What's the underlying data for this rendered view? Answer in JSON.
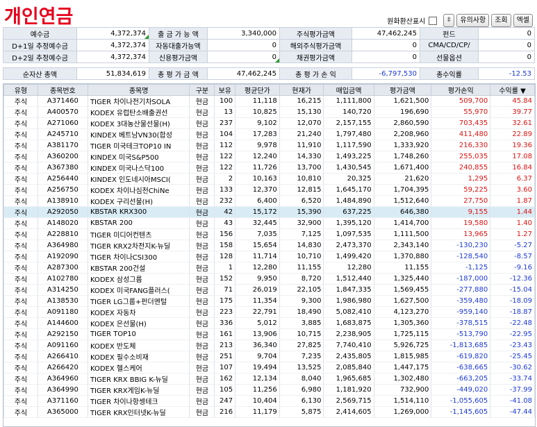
{
  "title": "개인연금",
  "controls": {
    "fx_label": "원화환산표시",
    "notes_label": "유의사항",
    "query_label": "조회",
    "excel_label": "엑셀"
  },
  "summary": {
    "r1": [
      "예수금",
      "4,372,374",
      "출 금 가 능 액",
      "3,340,000",
      "주식평가금액",
      "47,462,245",
      "펀드",
      "0"
    ],
    "r2": [
      "D+1일 추정예수금",
      "4,372,374",
      "자동대출가능액",
      "0",
      "해외주식평가금액",
      "0",
      "CMA/CD/CP/",
      "0"
    ],
    "r3": [
      "D+2일 추정예수금",
      "4,372,374",
      "신용평가금액",
      "0",
      "채권평가금액",
      "0",
      "선물옵션",
      "0"
    ],
    "r4": [
      "순자산 총액",
      "51,834,619",
      "총 평 가 금 액",
      "47,462,245",
      "총 평 가 손 익",
      "-6,797,530",
      "총수익률",
      "-12.53"
    ]
  },
  "columns": [
    "유형",
    "종목번호",
    "종목명",
    "구분",
    "보유",
    "평균단가",
    "현재가",
    "매입금액",
    "평가금액",
    "평가손익",
    "수익률 ▼"
  ],
  "rows": [
    [
      "주식",
      "A371460",
      "TIGER 차이나전기차SOLA",
      "현금",
      "100",
      "11,118",
      "16,215",
      "1,111,800",
      "1,621,500",
      "509,700",
      "45.84"
    ],
    [
      "주식",
      "A400570",
      "KODEX 유럽탄소배출권선",
      "현금",
      "13",
      "10,825",
      "15,130",
      "140,720",
      "196,690",
      "55,970",
      "39.77"
    ],
    [
      "주식",
      "A271060",
      "KODEX 3대농산물선물(H)",
      "현금",
      "237",
      "9,102",
      "12,070",
      "2,157,155",
      "2,860,590",
      "703,435",
      "32.61"
    ],
    [
      "주식",
      "A245710",
      "KINDEX 베트남VN30(합성",
      "현금",
      "104",
      "17,283",
      "21,240",
      "1,797,480",
      "2,208,960",
      "411,480",
      "22.89"
    ],
    [
      "주식",
      "A381170",
      "TIGER 미국테크TOP10 IN",
      "현금",
      "112",
      "9,978",
      "11,910",
      "1,117,590",
      "1,333,920",
      "216,330",
      "19.36"
    ],
    [
      "주식",
      "A360200",
      "KINDEX 미국S&P500",
      "현금",
      "122",
      "12,240",
      "14,330",
      "1,493,225",
      "1,748,260",
      "255,035",
      "17.08"
    ],
    [
      "주식",
      "A367380",
      "KINDEX 미국나스닥100",
      "현금",
      "122",
      "11,726",
      "13,700",
      "1,430,545",
      "1,671,400",
      "240,855",
      "16.84"
    ],
    [
      "주식",
      "A256440",
      "KINDEX 인도네시아MSCI(",
      "현금",
      "2",
      "10,163",
      "10,810",
      "20,325",
      "21,620",
      "1,295",
      "6.37"
    ],
    [
      "주식",
      "A256750",
      "KODEX 차이나심천ChiNe",
      "현금",
      "133",
      "12,370",
      "12,815",
      "1,645,170",
      "1,704,395",
      "59,225",
      "3.60"
    ],
    [
      "주식",
      "A138910",
      "KODEX 구리선물(H)",
      "현금",
      "232",
      "6,400",
      "6,520",
      "1,484,890",
      "1,512,640",
      "27,750",
      "1.87"
    ],
    [
      "주식",
      "A292050",
      "KBSTAR KRX300",
      "현금",
      "42",
      "15,172",
      "15,390",
      "637,225",
      "646,380",
      "9,155",
      "1.44"
    ],
    [
      "주식",
      "A148020",
      "KBSTAR 200",
      "현금",
      "43",
      "32,445",
      "32,900",
      "1,395,120",
      "1,414,700",
      "19,580",
      "1.40"
    ],
    [
      "주식",
      "A228810",
      "TIGER 미디어컨텐츠",
      "현금",
      "156",
      "7,035",
      "7,125",
      "1,097,535",
      "1,111,500",
      "13,965",
      "1.27"
    ],
    [
      "주식",
      "A364980",
      "TIGER KRX2차전지K-뉴딜",
      "현금",
      "158",
      "15,654",
      "14,830",
      "2,473,370",
      "2,343,140",
      "-130,230",
      "-5.27"
    ],
    [
      "주식",
      "A192090",
      "TIGER 차이나CSI300",
      "현금",
      "128",
      "11,714",
      "10,710",
      "1,499,420",
      "1,370,880",
      "-128,540",
      "-8.57"
    ],
    [
      "주식",
      "A287300",
      "KBSTAR 200건설",
      "현금",
      "1",
      "12,280",
      "11,155",
      "12,280",
      "11,155",
      "-1,125",
      "-9.16"
    ],
    [
      "주식",
      "A102780",
      "KODEX 삼성그룹",
      "현금",
      "152",
      "9,950",
      "8,720",
      "1,512,440",
      "1,325,440",
      "-187,000",
      "-12.36"
    ],
    [
      "주식",
      "A314250",
      "KODEX 미국FANG플러스(",
      "현금",
      "71",
      "26,019",
      "22,105",
      "1,847,335",
      "1,569,455",
      "-277,880",
      "-15.04"
    ],
    [
      "주식",
      "A138530",
      "TIGER LG그룹+펀더멘털",
      "현금",
      "175",
      "11,354",
      "9,300",
      "1,986,980",
      "1,627,500",
      "-359,480",
      "-18.09"
    ],
    [
      "주식",
      "A091180",
      "KODEX 자동차",
      "현금",
      "223",
      "22,791",
      "18,490",
      "5,082,410",
      "4,123,270",
      "-959,140",
      "-18.87"
    ],
    [
      "주식",
      "A144600",
      "KODEX 은선물(H)",
      "현금",
      "336",
      "5,012",
      "3,885",
      "1,683,875",
      "1,305,360",
      "-378,515",
      "-22.48"
    ],
    [
      "주식",
      "A292150",
      "TIGER TOP10",
      "현금",
      "161",
      "13,906",
      "10,715",
      "2,238,905",
      "1,725,115",
      "-513,790",
      "-22.95"
    ],
    [
      "주식",
      "A091160",
      "KODEX 반도체",
      "현금",
      "213",
      "36,340",
      "27,825",
      "7,740,410",
      "5,926,725",
      "-1,813,685",
      "-23.43"
    ],
    [
      "주식",
      "A266410",
      "KODEX 필수소비재",
      "현금",
      "251",
      "9,704",
      "7,235",
      "2,435,805",
      "1,815,985",
      "-619,820",
      "-25.45"
    ],
    [
      "주식",
      "A266420",
      "KODEX 헬스케어",
      "현금",
      "107",
      "19,494",
      "13,525",
      "2,085,840",
      "1,447,175",
      "-638,665",
      "-30.62"
    ],
    [
      "주식",
      "A364960",
      "TIGER KRX BBIG K-뉴딜",
      "현금",
      "162",
      "12,134",
      "8,040",
      "1,965,685",
      "1,302,480",
      "-663,205",
      "-33.74"
    ],
    [
      "주식",
      "A364990",
      "TIGER KRX게임K-뉴딜",
      "현금",
      "105",
      "11,256",
      "6,980",
      "1,181,920",
      "732,900",
      "-449,020",
      "-37.99"
    ],
    [
      "주식",
      "A371160",
      "TIGER 차이나항셍테크",
      "현금",
      "247",
      "10,404",
      "6,130",
      "2,569,715",
      "1,514,110",
      "-1,055,605",
      "-41.08"
    ],
    [
      "주식",
      "A365000",
      "TIGER KRX인터넷K-뉴딜",
      "현금",
      "216",
      "11,179",
      "5,875",
      "2,414,605",
      "1,269,000",
      "-1,145,605",
      "-47.44"
    ]
  ],
  "selected_row": 10,
  "colors": {
    "positive": "#e01010",
    "negative": "#1c39d8",
    "title": "#e6001c",
    "header_bg": "#e7ecf3",
    "selected_bg": "#d9ecf6"
  }
}
